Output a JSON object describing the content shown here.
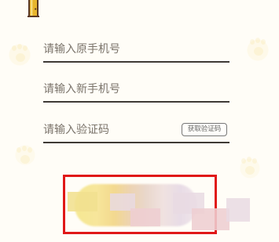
{
  "form": {
    "old_phone_placeholder": "请输入原手机号",
    "new_phone_placeholder": "请输入新手机号",
    "verification_code_placeholder": "请输入验证码",
    "get_code_label": "获取验证码"
  },
  "colors": {
    "background": "#fffdf7",
    "underline": "#3f3a36",
    "placeholder_text": "#7b746b",
    "highlight_border": "#e01818",
    "door_brown": "#5a3824",
    "door_gold": "#e8b52d"
  },
  "icons": {
    "door": "door-icon",
    "paw_pattern": "paw-icon"
  }
}
